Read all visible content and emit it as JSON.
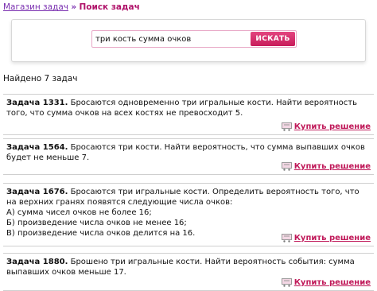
{
  "breadcrumb": {
    "shop_link": "Магазин задач",
    "separator": "»",
    "current": "Поиск задач"
  },
  "search": {
    "value": "три кость сумма очков",
    "button_label": "ИСКАТЬ"
  },
  "results": {
    "found_text": "Найдено 7 задач"
  },
  "tasks": [
    {
      "number": "Задача 1331.",
      "text": "Бросаются одновременно три игральные кости. Найти вероятность того, что сумма очков на всех костях не превосходит 5.",
      "buy_label": "Купить решение"
    },
    {
      "number": "Задача 1564.",
      "text": "Бросаются три кости. Найти вероятность, что сумма выпавших очков будет не меньше 7.",
      "buy_label": "Купить решение"
    },
    {
      "number": "Задача 1676.",
      "text": "Бросаются три игральные кости. Определить вероятность того, что на верхних гранях появятся следующие числа очков:",
      "items": [
        "А) сумма чисел очков не более 16;",
        "Б) произведение числа очков не менее 16;",
        "В) произведение числа очков делится на 16."
      ],
      "buy_label": "Купить решение"
    },
    {
      "number": "Задача 1880.",
      "text": "Брошено три игральные кости. Найти вероятность события: сумма выпавших очков меньше 17.",
      "buy_label": "Купить решение"
    }
  ],
  "colors": {
    "accent": "#c81b5a",
    "link": "#7a2fb0"
  }
}
